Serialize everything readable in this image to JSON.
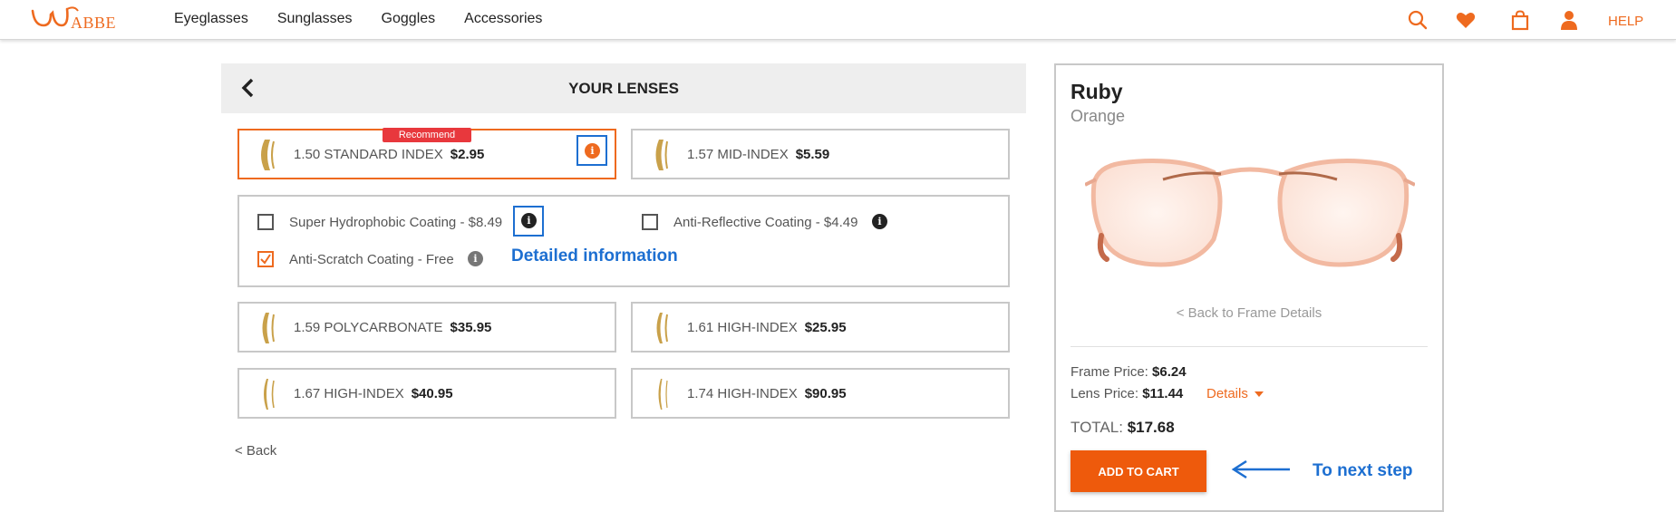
{
  "brand": {
    "name": "ABBE",
    "color": "#ee6a1f"
  },
  "nav": {
    "items": [
      "Eyeglasses",
      "Sunglasses",
      "Goggles",
      "Accessories"
    ]
  },
  "header_icons": [
    "search-icon",
    "heart-icon",
    "bag-icon",
    "user-icon"
  ],
  "help_label": "HELP",
  "lenses": {
    "title": "YOUR LENSES",
    "options": [
      {
        "name": "1.50 STANDARD INDEX",
        "price": "$2.95",
        "selected": true,
        "badge": "Recommend"
      },
      {
        "name": "1.57 MID-INDEX",
        "price": "$5.59"
      },
      {
        "name": "1.59 POLYCARBONATE",
        "price": "$35.95"
      },
      {
        "name": "1.61 HIGH-INDEX",
        "price": "$25.95"
      },
      {
        "name": "1.67 HIGH-INDEX",
        "price": "$40.95"
      },
      {
        "name": "1.74 HIGH-INDEX",
        "price": "$90.95"
      }
    ],
    "coatings": [
      {
        "label": "Super Hydrophobic Coating - $8.49",
        "checked": false
      },
      {
        "label": "Anti-Reflective Coating - $4.49",
        "checked": false
      },
      {
        "label": "Anti-Scratch Coating - Free",
        "checked": true
      }
    ],
    "annotation": "Detailed information",
    "back_label": "< Back"
  },
  "summary": {
    "product_name": "Ruby",
    "product_color": "Orange",
    "back_to_frame": "< Back to Frame Details",
    "frame_price_label": "Frame Price:",
    "frame_price": "$6.24",
    "lens_price_label": "Lens Price:",
    "lens_price": "$11.44",
    "details_label": "Details",
    "total_label": "TOTAL:",
    "total": "$17.68",
    "add_to_cart": "ADD TO CART",
    "annotation": "To next step"
  },
  "colors": {
    "accent": "#ee6a1f",
    "annotation": "#1d6fd1",
    "badge": "#e8383d"
  }
}
